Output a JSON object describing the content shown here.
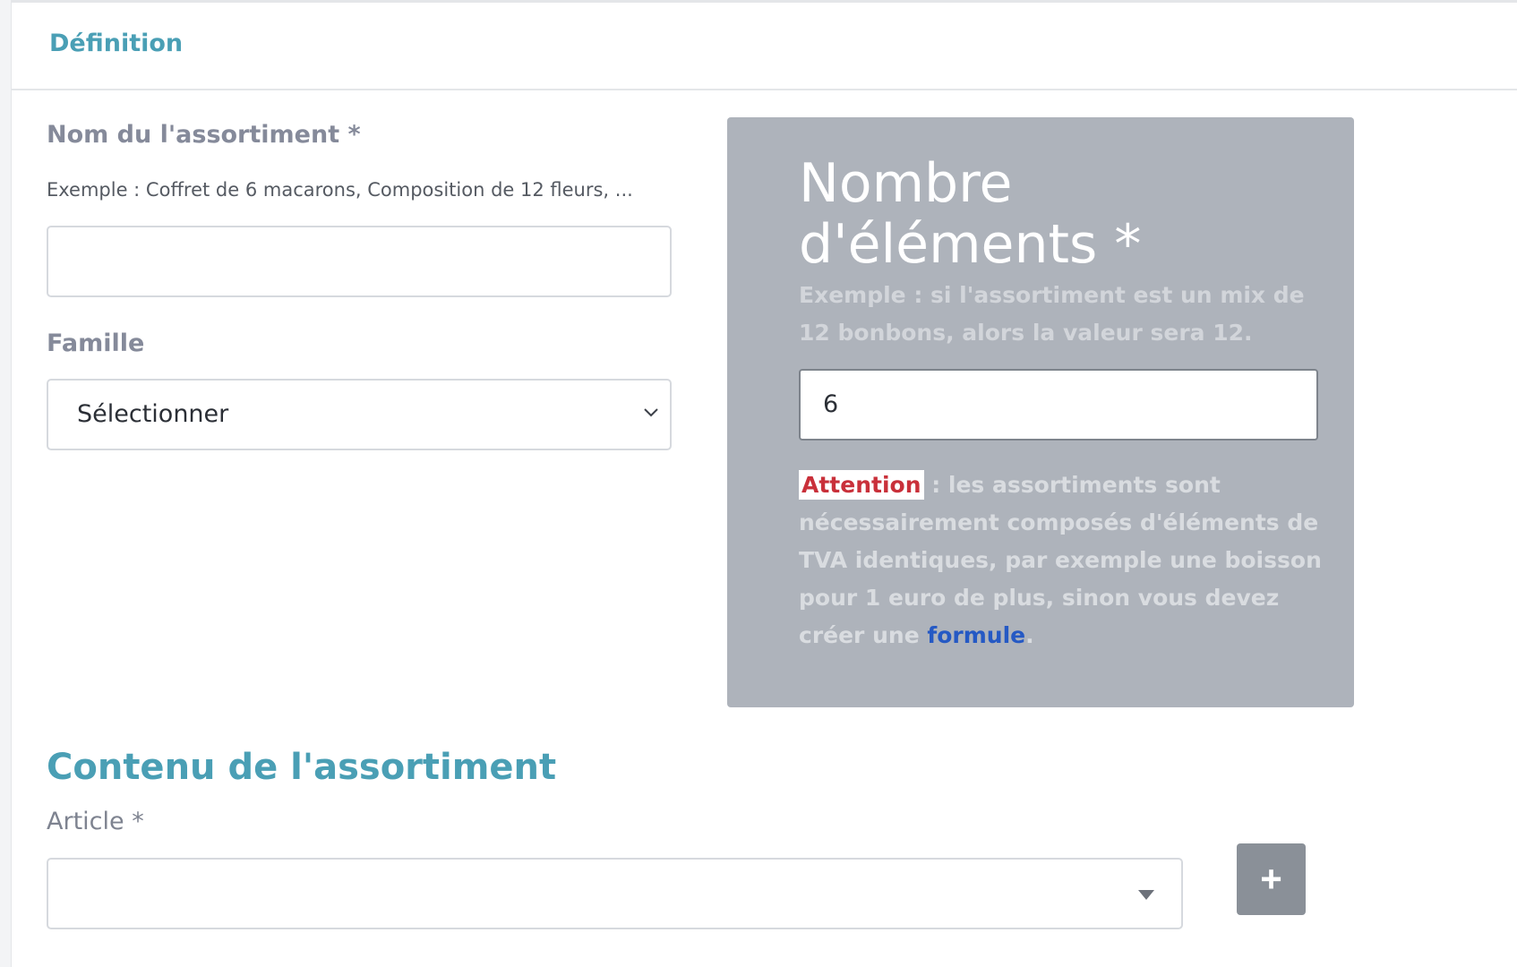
{
  "tab": {
    "title": "Définition"
  },
  "form": {
    "name_label": "Nom du l'assortiment *",
    "name_hint": "Exemple : Coffret de 6 macarons, Composition de 12 fleurs, ...",
    "name_value": "",
    "family_label": "Famille",
    "family_selected": "Sélectionner"
  },
  "panel": {
    "title": "Nombre d'éléments *",
    "hint": "Exemple : si l'assortiment est un mix de 12 bonbons, alors la valeur sera 12.",
    "count_value": "6",
    "warning_badge": "Attention",
    "warning_text": " : les assortiments sont nécessairement composés d'éléments de TVA identiques, par exemple une boisson pour 1 euro de plus, sinon vous devez créer une ",
    "warning_link": "formule",
    "warning_end": "."
  },
  "content_section": {
    "title": "Contenu de l'assortiment",
    "article_label": "Article *",
    "article_selected": "",
    "add_button_label": "+"
  },
  "colors": {
    "accent": "#4a9fb5",
    "panel_bg": "#aeb3bb",
    "attention_red": "#c9303a",
    "link_blue": "#2559c4",
    "button_grey": "#8a9098"
  }
}
